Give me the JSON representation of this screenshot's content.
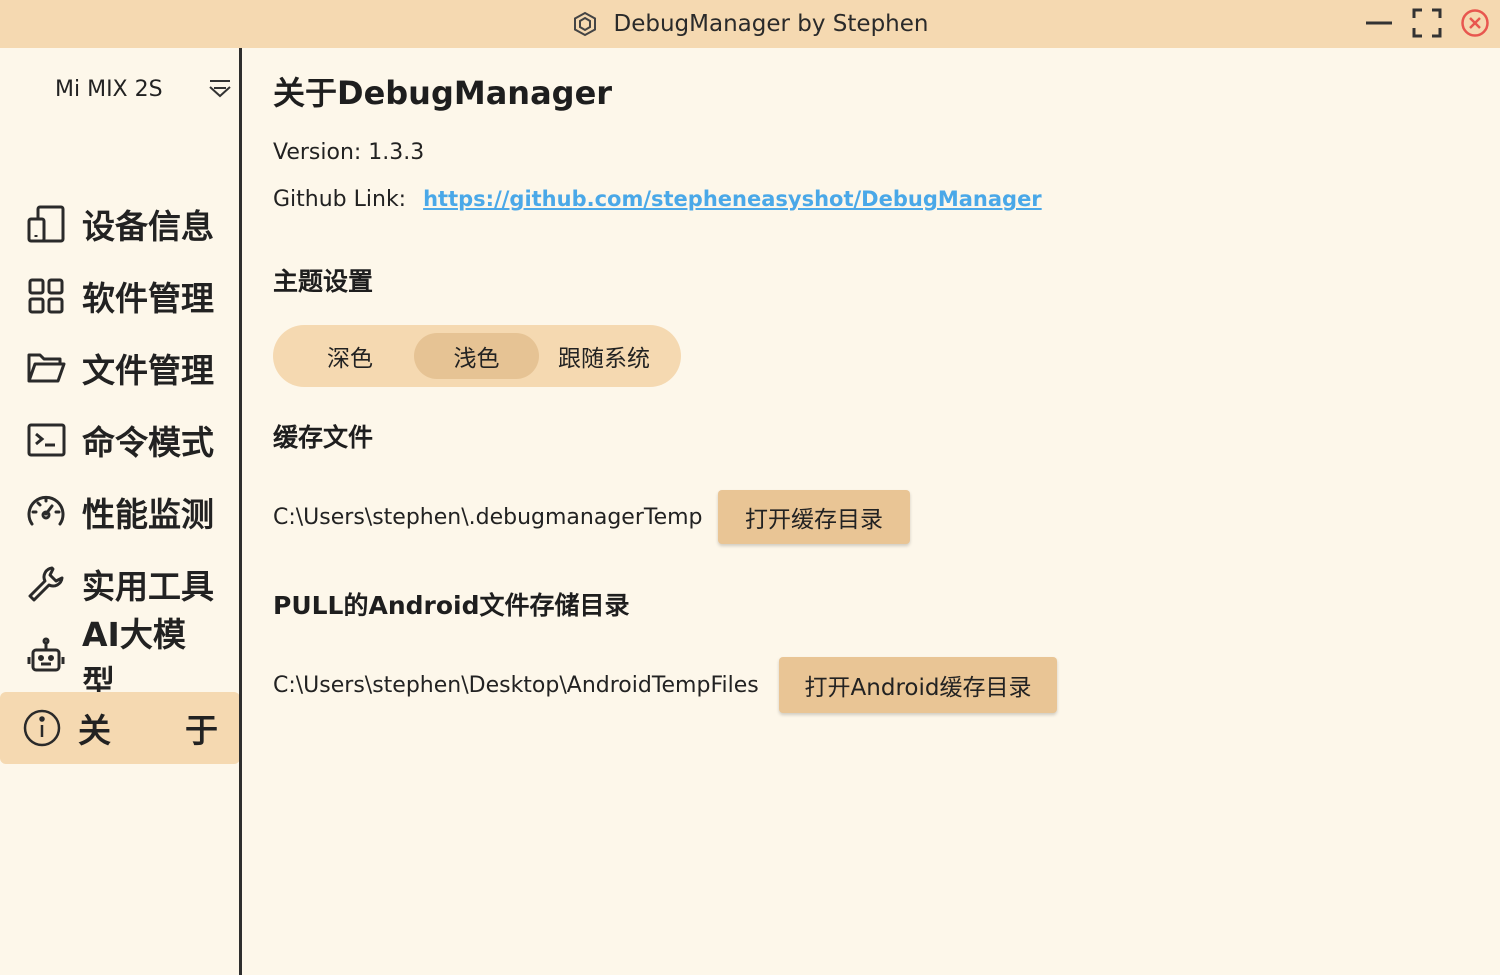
{
  "window": {
    "title": "DebugManager by Stephen",
    "icons": [
      "app-hex-icon",
      "minimize-icon",
      "fullscreen-icon",
      "close-icon"
    ],
    "accent_close": "#e8574f"
  },
  "sidebar": {
    "device": "Mi MIX 2S",
    "items": [
      {
        "label": "设备信息",
        "icon": "device-info-icon"
      },
      {
        "label": "软件管理",
        "icon": "apps-grid-icon"
      },
      {
        "label": "文件管理",
        "icon": "folder-icon"
      },
      {
        "label": "命令模式",
        "icon": "terminal-icon"
      },
      {
        "label": "性能监测",
        "icon": "speedometer-icon"
      },
      {
        "label": "实用工具",
        "icon": "wrench-icon"
      },
      {
        "label": "AI大模型",
        "icon": "robot-icon"
      },
      {
        "label_left": "关",
        "label_right": "于",
        "icon": "info-icon",
        "active": true
      }
    ]
  },
  "about": {
    "title": "关于DebugManager",
    "version": "Version: 1.3.3",
    "github_label": "Github Link:",
    "github_url": "https://github.com/stepheneasyshot/DebugManager"
  },
  "theme": {
    "heading": "主题设置",
    "options": [
      "深色",
      "浅色",
      "跟随系统"
    ],
    "selected": "浅色"
  },
  "cache": {
    "heading": "缓存文件",
    "path": "C:\\Users\\stephen\\.debugmanagerTemp",
    "button": "打开缓存目录"
  },
  "android_pull": {
    "heading": "PULL的Android文件存储目录",
    "path": "C:\\Users\\stephen\\Desktop\\AndroidTempFiles",
    "button": "打开Android缓存目录"
  },
  "colors": {
    "titlebar": "#f5d9b1",
    "background": "#fdf7ea",
    "button": "#e9c595",
    "link": "#4aa8e8"
  }
}
